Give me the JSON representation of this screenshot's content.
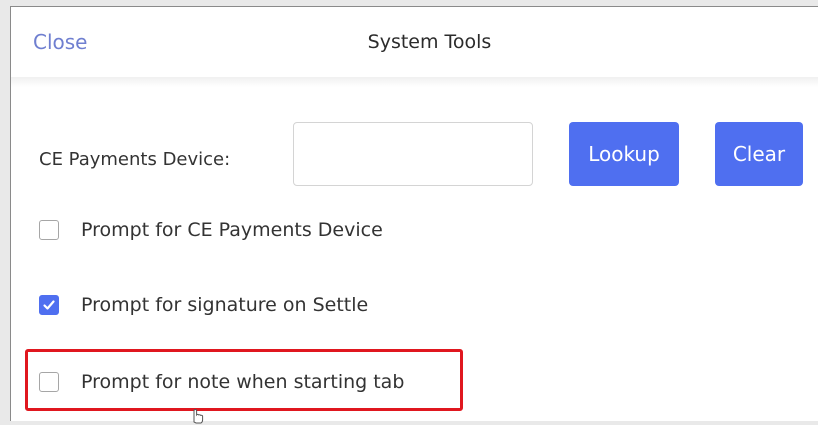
{
  "header": {
    "close_label": "Close",
    "title": "System Tools"
  },
  "device": {
    "label": "CE Payments Device:",
    "value": "",
    "lookup_label": "Lookup",
    "clear_label": "Clear"
  },
  "options": [
    {
      "label": "Prompt for CE Payments Device",
      "checked": false
    },
    {
      "label": "Prompt for signature on Settle",
      "checked": true
    },
    {
      "label": "Prompt for note when starting tab",
      "checked": false
    }
  ],
  "colors": {
    "accent": "#4f6ff0",
    "link": "#6f7fd0",
    "highlight": "#e0171f"
  },
  "icons": {
    "checkmark": "check-icon",
    "pointer": "hand-pointer-icon"
  }
}
